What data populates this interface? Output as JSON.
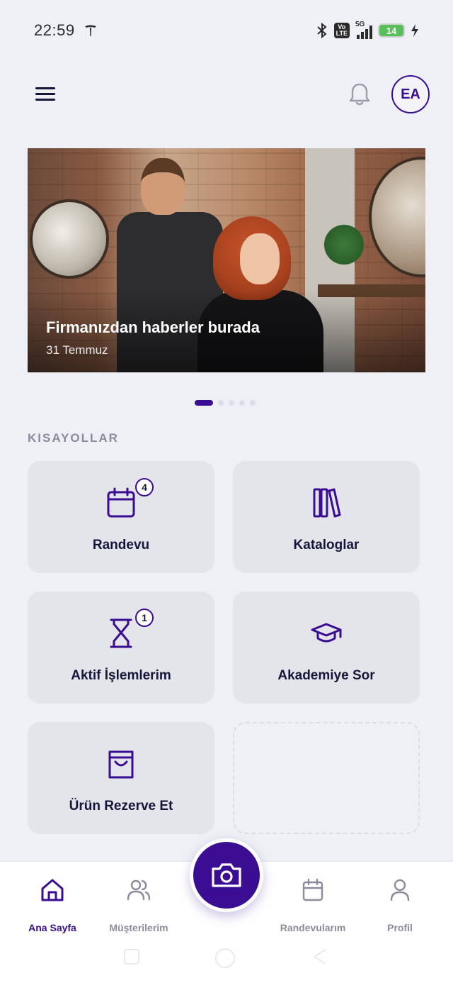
{
  "status_bar": {
    "time": "22:59",
    "network": "5G",
    "volte": "Vo LTE",
    "battery": "14",
    "icons": [
      "tesla-icon",
      "bluetooth-icon",
      "volte-icon",
      "signal-icon",
      "battery-icon",
      "charging-icon"
    ]
  },
  "header": {
    "menu_icon": "hamburger-menu-icon",
    "notification_icon": "bell-icon",
    "avatar_initials": "EA"
  },
  "banner": {
    "title": "Firmanızdan haberler burada",
    "date": "31 Temmuz",
    "image": "hair-salon-photo",
    "slides": 5,
    "active_slide": 1
  },
  "shortcuts": {
    "title": "KISAYOLLAR",
    "items": [
      {
        "label": "Randevu",
        "icon": "calendar-icon",
        "badge": "4"
      },
      {
        "label": "Kataloglar",
        "icon": "books-icon",
        "badge": ""
      },
      {
        "label": "Aktif İşlemlerim",
        "icon": "hourglass-icon",
        "badge": "1"
      },
      {
        "label": "Akademiye Sor",
        "icon": "graduation-cap-icon",
        "badge": ""
      },
      {
        "label": "Ürün Rezerve Et",
        "icon": "shopping-bag-icon",
        "badge": ""
      }
    ]
  },
  "bottom_nav": {
    "items": [
      {
        "label": "Ana Sayfa",
        "icon": "home-icon",
        "active": true
      },
      {
        "label": "Müşterilerim",
        "icon": "users-icon",
        "active": false
      },
      {
        "label": "Randevularım",
        "icon": "calendar-icon",
        "active": false
      },
      {
        "label": "Profil",
        "icon": "user-icon",
        "active": false
      }
    ],
    "center_action_icon": "camera-icon"
  },
  "colors": {
    "primary": "#3a0d93",
    "background": "#eef0f5",
    "card": "#e4e5ea",
    "muted_text": "#8a8c9e"
  }
}
